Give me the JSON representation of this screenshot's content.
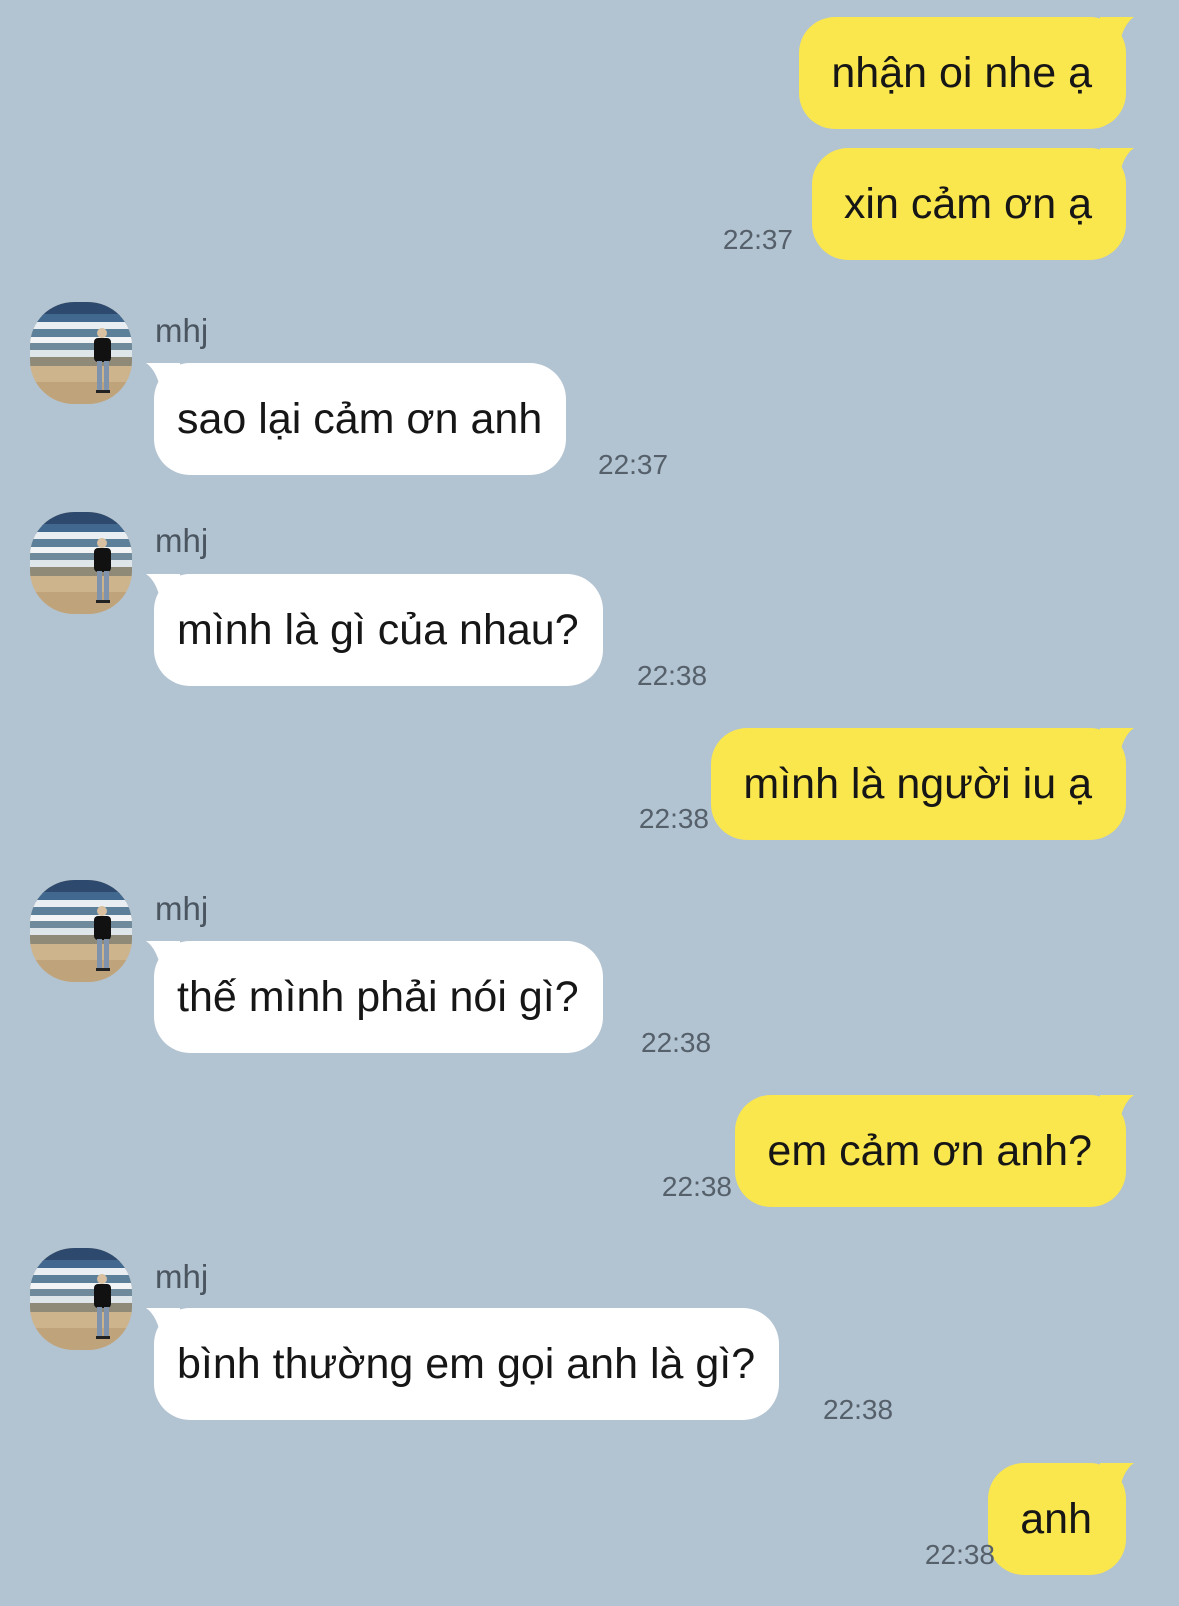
{
  "chat": {
    "contact_name": "mhj",
    "colors": {
      "background": "#b2c3d2",
      "outgoing_bubble": "#fae64d",
      "incoming_bubble": "#ffffff",
      "timestamp": "#55606a"
    },
    "messages": [
      {
        "direction": "out",
        "text": "nhận oi nhe ạ",
        "time": ""
      },
      {
        "direction": "out",
        "text": "xin cảm ơn ạ",
        "time": "22:37"
      },
      {
        "direction": "in",
        "sender": "mhj",
        "text": "sao lại cảm ơn anh",
        "time": "22:37"
      },
      {
        "direction": "in",
        "sender": "mhj",
        "text": "mình là gì của nhau?",
        "time": "22:38"
      },
      {
        "direction": "out",
        "text": "mình là người iu ạ",
        "time": "22:38"
      },
      {
        "direction": "in",
        "sender": "mhj",
        "text": "thế mình phải nói gì?",
        "time": "22:38"
      },
      {
        "direction": "out",
        "text": "em cảm ơn anh?",
        "time": "22:38"
      },
      {
        "direction": "in",
        "sender": "mhj",
        "text": "bình thường em gọi anh là gì?",
        "time": "22:38"
      },
      {
        "direction": "out",
        "text": "anh",
        "time": "22:38"
      }
    ]
  }
}
